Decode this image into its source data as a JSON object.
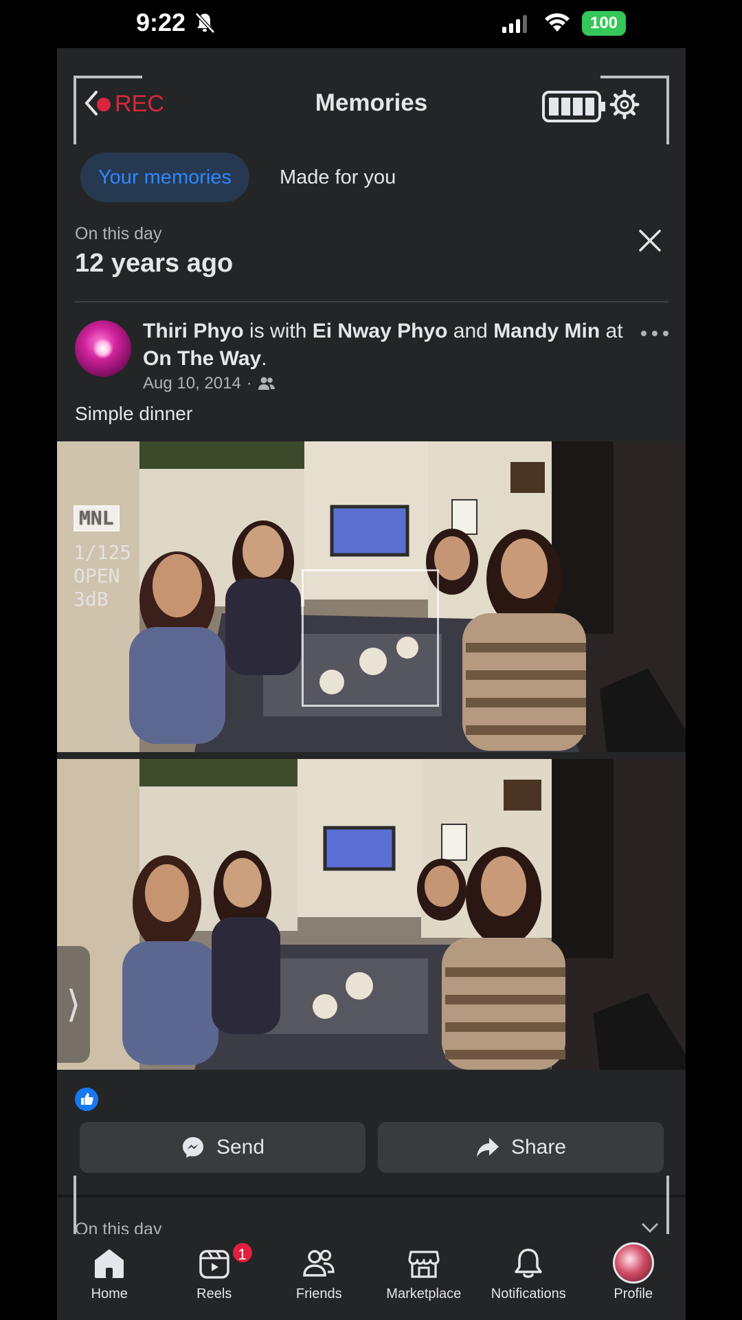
{
  "status_bar": {
    "time": "9:22",
    "battery": "100"
  },
  "header": {
    "rec_label": "REC",
    "title": "Memories"
  },
  "tabs": [
    {
      "label": "Your memories",
      "active": true
    },
    {
      "label": "Made for you",
      "active": false
    }
  ],
  "memory": {
    "section_label": "On this day",
    "years_ago": "12 years ago",
    "post": {
      "author": "Thiri Phyo",
      "connector_with": " is with ",
      "tagged_1": "Ei Nway Phyo",
      "connector_and": " and ",
      "tagged_2": "Mandy Min",
      "connector_at": " at ",
      "place": "On The Way",
      "period": ".",
      "date": "Aug 10, 2014",
      "separator": "·",
      "audience_icon": "friends-icon",
      "text": "Simple dinner"
    }
  },
  "camera_overlay": {
    "badge": "MNL",
    "shutter": "1/125",
    "aperture": "OPEN",
    "gain": "3dB"
  },
  "actions": {
    "send_label": "Send",
    "share_label": "Share"
  },
  "next_memory_peek": "On this day",
  "bottom_nav": [
    {
      "label": "Home",
      "icon": "home-icon",
      "active": true
    },
    {
      "label": "Reels",
      "icon": "reels-icon",
      "badge": "1"
    },
    {
      "label": "Friends",
      "icon": "friends-icon"
    },
    {
      "label": "Marketplace",
      "icon": "marketplace-icon"
    },
    {
      "label": "Notifications",
      "icon": "bell-icon"
    },
    {
      "label": "Profile",
      "icon": "profile-avatar"
    }
  ],
  "colors": {
    "background": "#242526",
    "accent": "#2d88ff",
    "active_tab_bg": "#263951",
    "rec_red": "#d9263c",
    "badge_red": "#e41e3f"
  }
}
